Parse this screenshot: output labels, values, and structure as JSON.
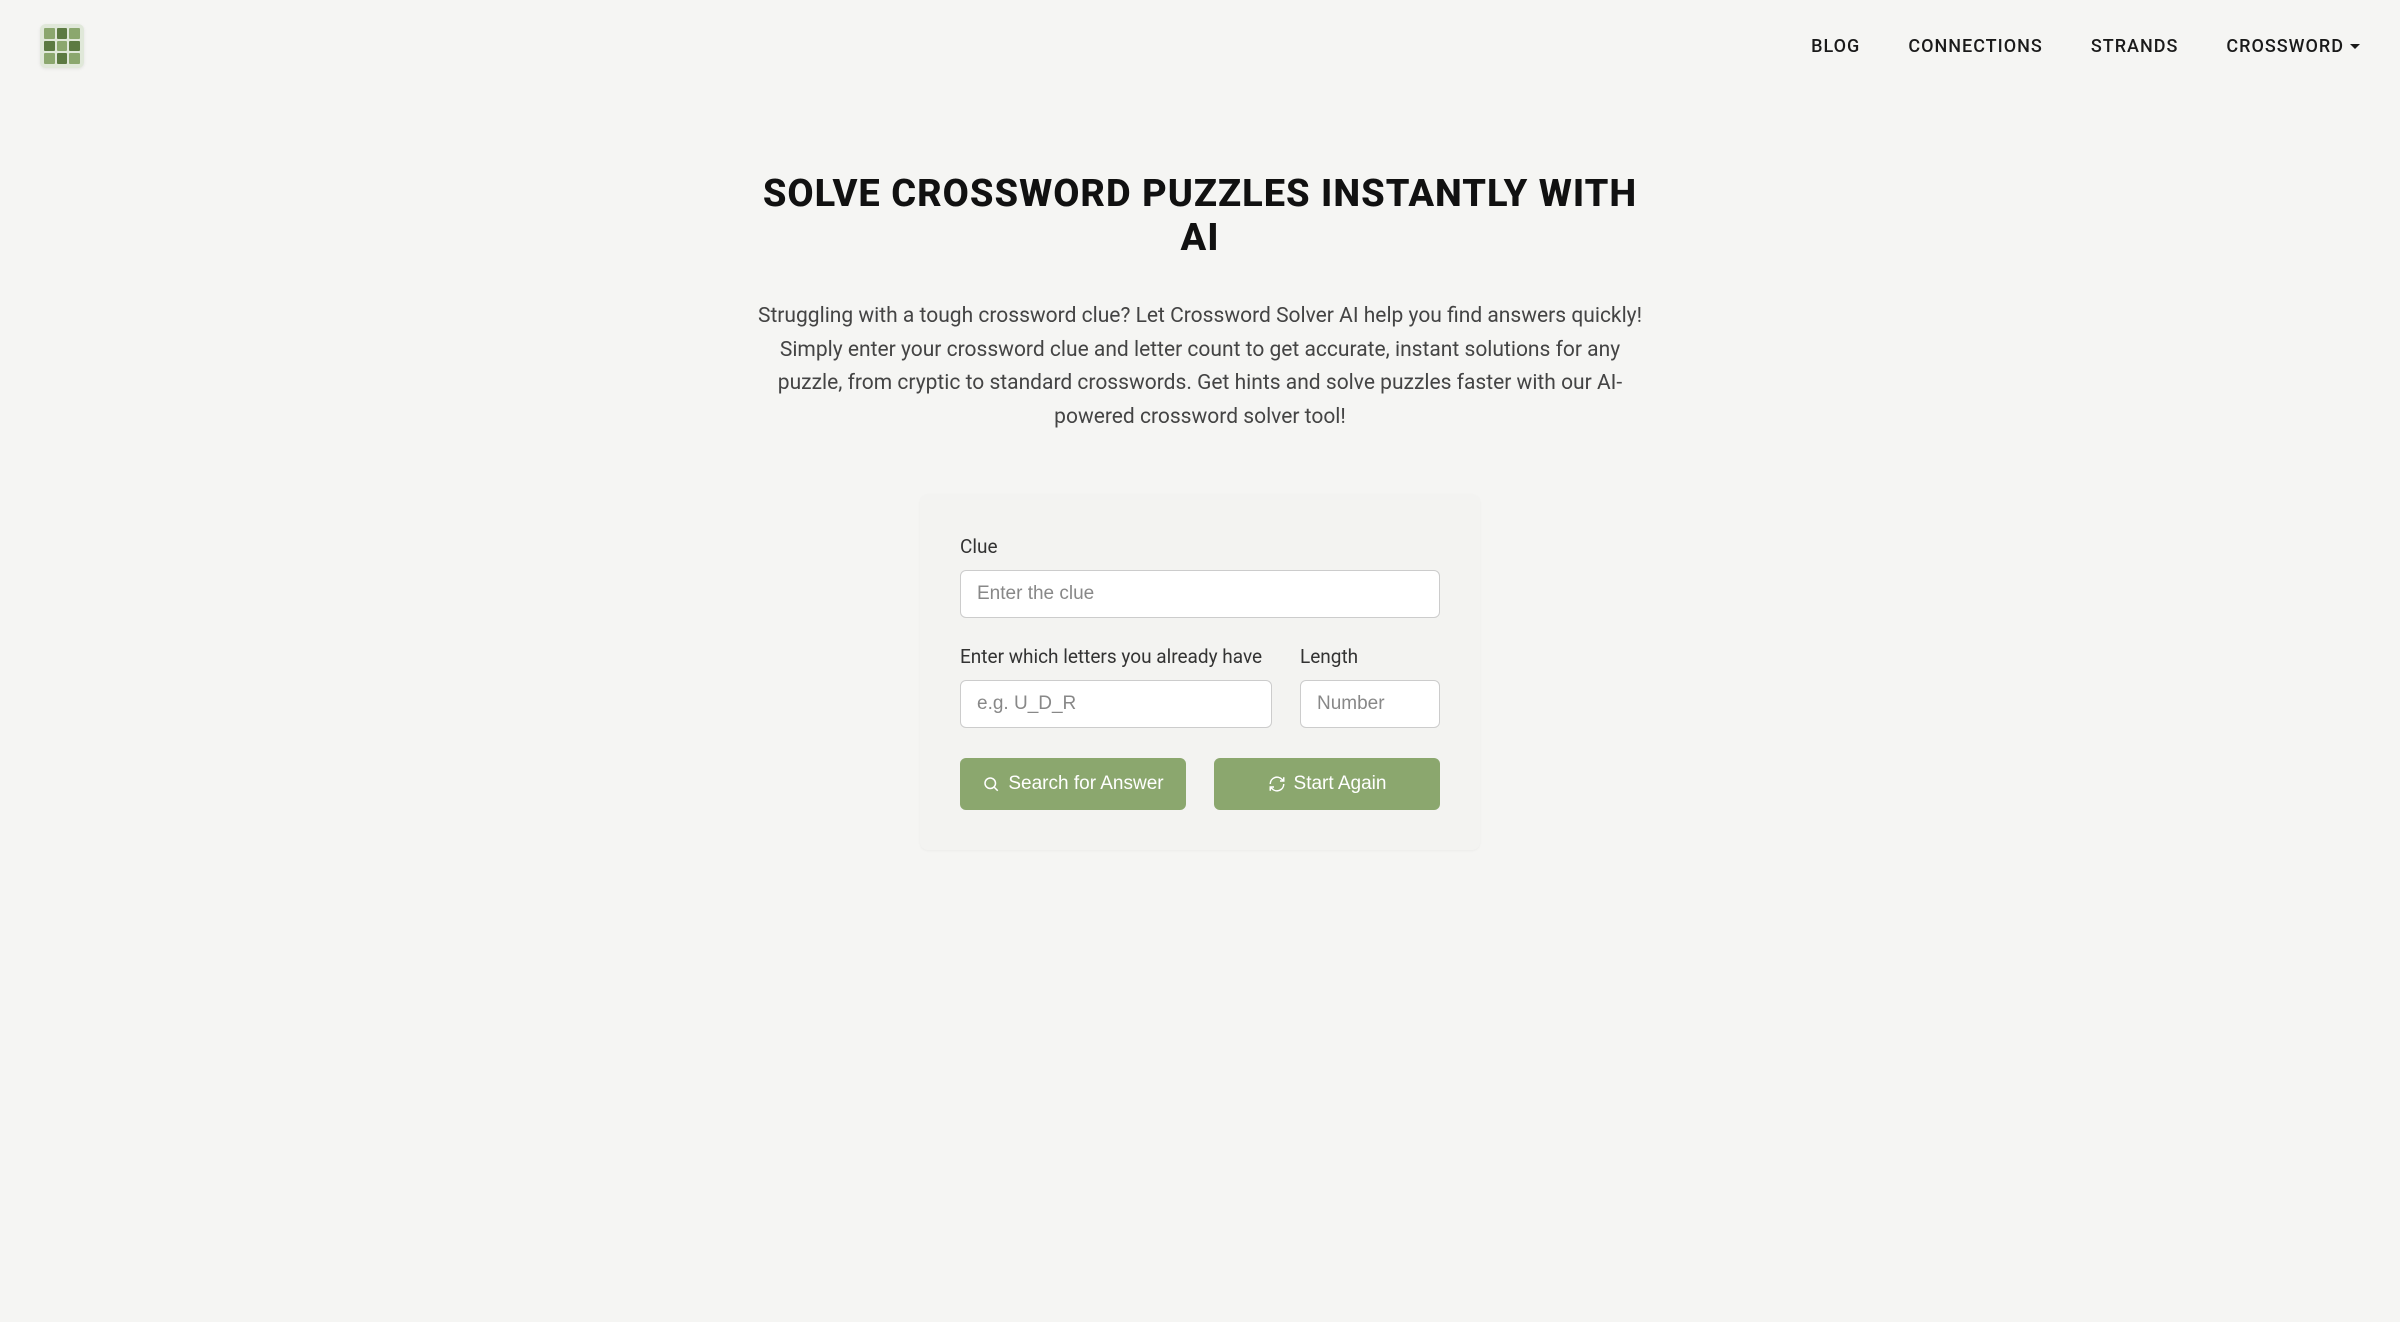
{
  "nav": {
    "items": [
      {
        "label": "BLOG"
      },
      {
        "label": "CONNECTIONS"
      },
      {
        "label": "STRANDS"
      },
      {
        "label": "CROSSWORD",
        "dropdown": true
      }
    ]
  },
  "hero": {
    "headline": "SOLVE CROSSWORD PUZZLES INSTANTLY WITH AI",
    "description": "Struggling with a tough crossword clue? Let Crossword Solver AI help you find answers quickly! Simply enter your crossword clue and letter count to get accurate, instant solutions for any puzzle, from cryptic to standard crosswords. Get hints and solve puzzles faster with our AI-powered crossword solver tool!"
  },
  "form": {
    "clue": {
      "label": "Clue",
      "placeholder": "Enter the clue",
      "value": ""
    },
    "letters": {
      "label": "Enter which letters you already have",
      "placeholder": "e.g. U_D_R",
      "value": ""
    },
    "length": {
      "label": "Length",
      "placeholder": "Number",
      "value": ""
    },
    "buttons": {
      "search": "Search for Answer",
      "reset": "Start Again"
    }
  }
}
